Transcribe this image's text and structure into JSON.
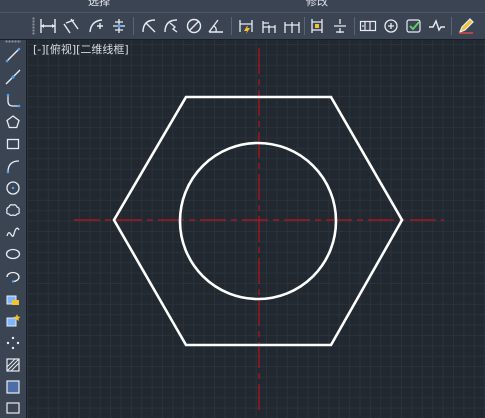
{
  "titlebar": {
    "tabs": [
      "选择",
      "修改"
    ]
  },
  "toolbar": {
    "icons": [
      "linear-dimension-icon",
      "aligned-dimension-icon",
      "arc-length-icon",
      "ordinate-dimension-icon",
      "radius-dimension-icon",
      "jogged-dimension-icon",
      "diameter-dimension-icon",
      "angular-dimension-icon",
      "quick-dimension-icon",
      "baseline-dimension-icon",
      "continue-dimension-icon",
      "dimension-space-icon",
      "dimension-break-icon",
      "tolerance-icon",
      "center-mark-icon",
      "inspection-icon",
      "jog-line-icon",
      "dimension-edit-icon"
    ]
  },
  "palette": {
    "icons": [
      "line-icon",
      "construction-line-icon",
      "polyline-icon",
      "polygon-icon",
      "rectangle-icon",
      "arc-icon",
      "circle-icon",
      "revision-cloud-icon",
      "spline-icon",
      "ellipse-icon",
      "ellipse-arc-icon",
      "insert-block-icon",
      "make-block-icon",
      "point-icon",
      "hatch-icon",
      "gradient-icon"
    ]
  },
  "viewport": {
    "label": "[-][俯视][二维线框]",
    "colors": {
      "background": "#212830",
      "geometry": "#ffffff",
      "centerline": "#c0121a"
    }
  }
}
